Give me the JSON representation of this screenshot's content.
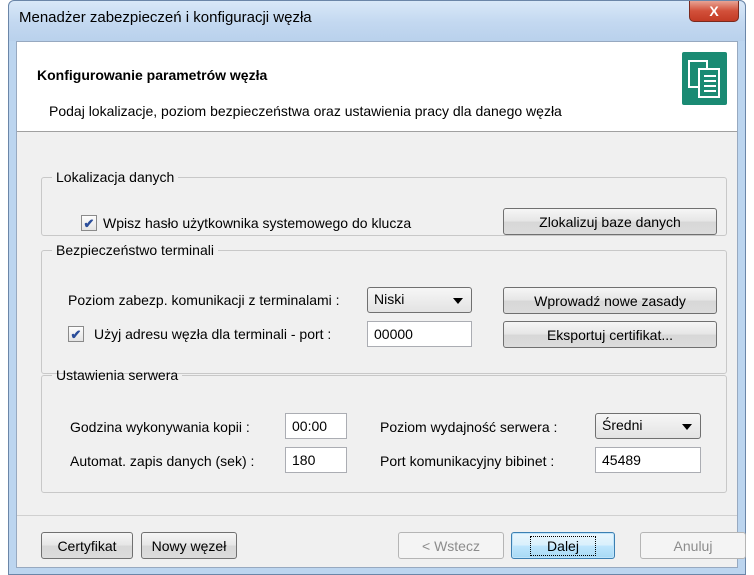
{
  "window": {
    "title": "Menadżer zabezpieczeń i konfiguracji węzła",
    "close_label": "X"
  },
  "header": {
    "title": "Konfigurowanie parametrów węzła",
    "subtitle": "Podaj lokalizacje, poziom bezpieczeństwa oraz ustawienia pracy dla danego węzła",
    "icon": "documents-icon"
  },
  "data_location": {
    "legend": "Lokalizacja danych",
    "checkbox_label": "Wpisz hasło użytkownika systemowego do klucza",
    "checkbox_checked": true,
    "locate_button": "Zlokalizuj baze danych"
  },
  "terminal_security": {
    "legend": "Bezpieczeństwo terminali",
    "level_label": "Poziom zabezp. komunikacji z terminalami :",
    "level_value": "Niski",
    "new_rules_button": "Wprowadź nowe zasady",
    "use_address_label": "Użyj adresu węzła dla terminali - port :",
    "use_address_checked": true,
    "port_value": "00000",
    "export_button": "Eksportuj certifikat..."
  },
  "server_settings": {
    "legend": "Ustawienia serwera",
    "backup_time_label": "Godzina  wykonywania kopii  :",
    "backup_time_value": "00:00",
    "autosave_label": "Automat. zapis danych  (sek) :",
    "autosave_value": "180",
    "performance_label": "Poziom wydajność serwera :",
    "performance_value": "Średni",
    "port_label": "Port komunikacyjny bibinet :",
    "port_value": "45489"
  },
  "footer": {
    "certificate_button": "Certyfikat",
    "new_node_button": "Nowy węzeł",
    "back_button": "< Wstecz",
    "next_button": "Dalej",
    "cancel_button": "Anuluj"
  },
  "colors": {
    "title_bar": "#c3d8f0",
    "close_button": "#d2503a",
    "header_icon": "#1a8a73",
    "checkmark": "#2a4d9a"
  }
}
